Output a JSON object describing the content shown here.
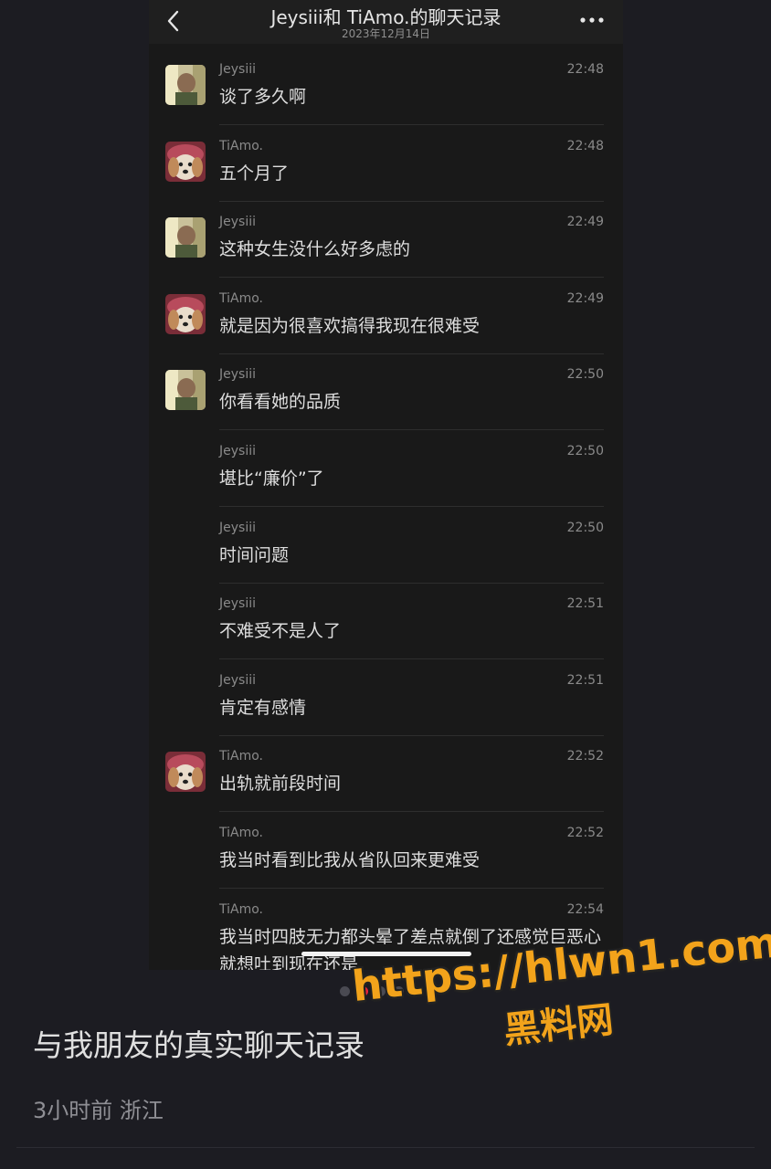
{
  "nav": {
    "title": "Jeysiii和 TiAmo.的聊天记录",
    "date": "2023年12月14日"
  },
  "messages": [
    {
      "sender": "Jeysiii",
      "time": "22:48",
      "text": "谈了多久啊",
      "avatar": "boy-avatar"
    },
    {
      "sender": "TiAmo.",
      "time": "22:48",
      "text": "五个月了",
      "avatar": "dog-avatar"
    },
    {
      "sender": "Jeysiii",
      "time": "22:49",
      "text": "这种女生没什么好多虑的",
      "avatar": "boy-avatar"
    },
    {
      "sender": "TiAmo.",
      "time": "22:49",
      "text": "就是因为很喜欢搞得我现在很难受",
      "avatar": "dog-avatar"
    },
    {
      "sender": "Jeysiii",
      "time": "22:50",
      "text": "你看看她的品质",
      "avatar": "boy-avatar"
    },
    {
      "sender": "Jeysiii",
      "time": "22:50",
      "text": "堪比“廉价”了",
      "avatar": ""
    },
    {
      "sender": "Jeysiii",
      "time": "22:50",
      "text": "时间问题",
      "avatar": ""
    },
    {
      "sender": "Jeysiii",
      "time": "22:51",
      "text": "不难受不是人了",
      "avatar": ""
    },
    {
      "sender": "Jeysiii",
      "time": "22:51",
      "text": "肯定有感情",
      "avatar": ""
    },
    {
      "sender": "TiAmo.",
      "time": "22:52",
      "text": "出轨就前段时间",
      "avatar": "dog-avatar"
    },
    {
      "sender": "TiAmo.",
      "time": "22:52",
      "text": "我当时看到比我从省队回来更难受",
      "avatar": ""
    },
    {
      "sender": "TiAmo.",
      "time": "22:54",
      "text": "我当时四肢无力都头晕了差点就倒了还感觉巨恶心就想吐到现在还是",
      "avatar": ""
    }
  ],
  "pager": {
    "count": 5,
    "active": 1,
    "active_color": "#e8243a"
  },
  "post": {
    "caption": "与我朋友的真实聊天记录",
    "meta": "3小时前 浙江"
  },
  "watermark": {
    "url": "https://hlwn1.com",
    "name": "黑料网"
  },
  "colors": {
    "accent": "#f2a31b"
  }
}
